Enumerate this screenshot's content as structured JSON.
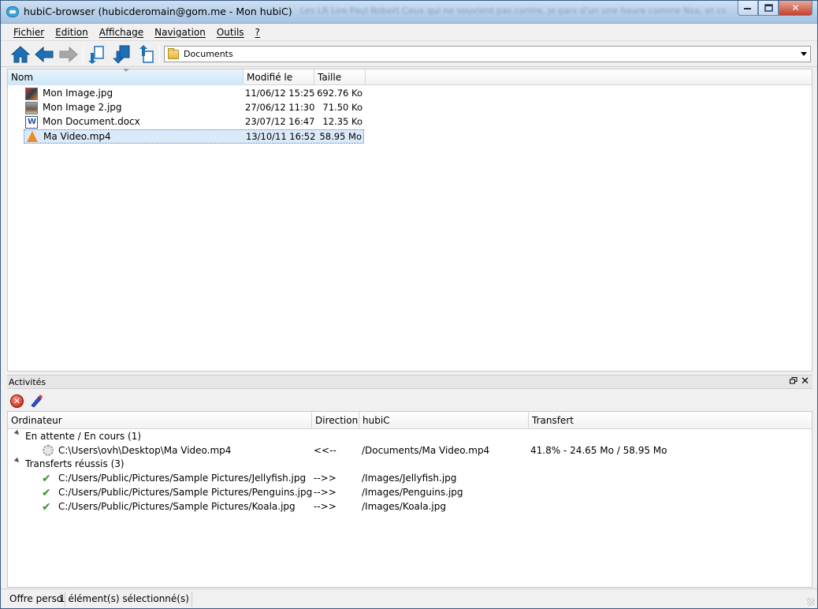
{
  "window": {
    "title": "hubiC-browser (hubicderomain@gom.me - Mon hubiC)",
    "blurred_text": "Les LR Lire Paul Robert Ceux qui ne souvient pas contre, je pars d'un une heure comme Nsa, et comme durant. Leurs ..."
  },
  "menu": {
    "items": [
      "Fichier",
      "Edition",
      "Affichage",
      "Navigation",
      "Outils",
      "?"
    ]
  },
  "toolbar": {
    "icons": [
      "home-icon",
      "back-icon",
      "forward-icon",
      "download-icon",
      "upload-icon",
      "new-folder-icon"
    ],
    "path": "Documents"
  },
  "file_list": {
    "columns": [
      "Nom",
      "Modifié le",
      "Taille"
    ],
    "rows": [
      {
        "name": "Mon Image.jpg",
        "date": "11/06/12 15:25",
        "size": "692.76 Ko",
        "icon": "image-icon"
      },
      {
        "name": "Mon Image 2.jpg",
        "date": "27/06/12 11:30",
        "size": "71.50 Ko",
        "icon": "image-icon"
      },
      {
        "name": "Mon Document.docx",
        "date": "23/07/12 16:47",
        "size": "12.35 Ko",
        "icon": "word-document-icon"
      },
      {
        "name": "Ma Video.mp4",
        "date": "13/10/11 16:52",
        "size": "58.95 Mo",
        "icon": "vlc-video-icon",
        "selected": true
      }
    ]
  },
  "activities": {
    "title": "Activités",
    "columns": [
      "Ordinateur",
      "Direction",
      "hubiC",
      "Transfert"
    ],
    "groups": [
      {
        "label": "En attente / En cours (1)",
        "items": [
          {
            "local": "C:\\Users\\ovh\\Desktop\\Ma Video.mp4",
            "direction": "<<--",
            "remote": "/Documents/Ma Video.mp4",
            "transfer": "41.8% - 24.65 Mo / 58.95 Mo",
            "status": "in-progress"
          }
        ]
      },
      {
        "label": "Transferts réussis (3)",
        "items": [
          {
            "local": "C:/Users/Public/Pictures/Sample Pictures/Jellyfish.jpg",
            "direction": "-->>",
            "remote": "/Images/Jellyfish.jpg",
            "transfer": "",
            "status": "done"
          },
          {
            "local": "C:/Users/Public/Pictures/Sample Pictures/Penguins.jpg",
            "direction": "-->>",
            "remote": "/Images/Penguins.jpg",
            "transfer": "",
            "status": "done"
          },
          {
            "local": "C:/Users/Public/Pictures/Sample Pictures/Koala.jpg",
            "direction": "-->>",
            "remote": "/Images/Koala.jpg",
            "transfer": "",
            "status": "done"
          }
        ]
      }
    ]
  },
  "status": {
    "plan": "Offre perso",
    "selection": "1 élément(s) sélectionné(s)"
  },
  "colors": {
    "accent": "#1e6fb4",
    "selection": "#dbeaf9",
    "success": "#2e9a1e",
    "stop": "#c0140a"
  }
}
